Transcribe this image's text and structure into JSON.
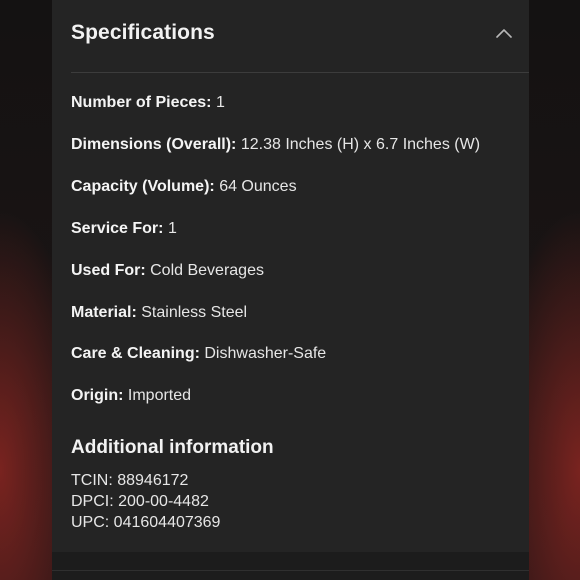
{
  "section": {
    "title": "Specifications",
    "chevron_icon": "chevron-up-icon"
  },
  "specs": [
    {
      "label": "Number of Pieces:",
      "value": "1"
    },
    {
      "label": "Dimensions (Overall):",
      "value": "12.38 Inches (H) x 6.7 Inches (W)"
    },
    {
      "label": "Capacity (Volume):",
      "value": "64 Ounces"
    },
    {
      "label": "Service For:",
      "value": "1"
    },
    {
      "label": "Used For:",
      "value": "Cold Beverages"
    },
    {
      "label": "Material:",
      "value": "Stainless Steel"
    },
    {
      "label": "Care & Cleaning:",
      "value": "Dishwasher-Safe"
    },
    {
      "label": "Origin:",
      "value": "Imported"
    }
  ],
  "additional": {
    "title": "Additional information",
    "tcin": "TCIN: 88946172",
    "dpci": "DPCI: 200-00-4482",
    "upc": "UPC: 041604407369"
  }
}
